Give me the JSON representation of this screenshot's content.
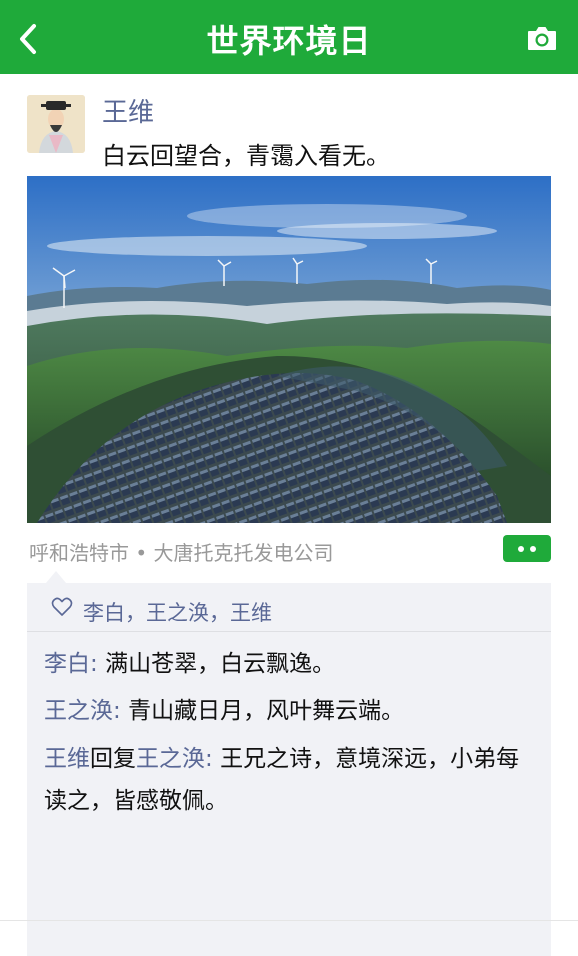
{
  "header": {
    "title": "世界环境日",
    "back_icon": "chevron-left-icon",
    "camera_icon": "camera-icon",
    "background": "#1faa3a"
  },
  "post": {
    "author": "王维",
    "text": "白云回望合，青霭入看无。",
    "image_description_icon": "landscape-photo",
    "location": "呼和浩特市 • 大唐托克托发电公司"
  },
  "likes": {
    "icon": "heart-outline-icon",
    "names": "李白，王之涣，王维"
  },
  "comments": [
    {
      "author": "李白",
      "separator": ":",
      "text": "满山苍翠，白云飘逸。"
    },
    {
      "author": "王之涣",
      "separator": ":",
      "text": "青山藏日月，风叶舞云端。"
    },
    {
      "author": "王维",
      "reply_word": "回复",
      "reply_to": "王之涣",
      "separator": ":",
      "text": "王兄之诗，意境深远，小弟每读之，皆感敬佩。"
    }
  ],
  "colors": {
    "accent": "#1faa3a",
    "name_link": "#5a6896",
    "comment_bg": "#f1f2f6"
  }
}
